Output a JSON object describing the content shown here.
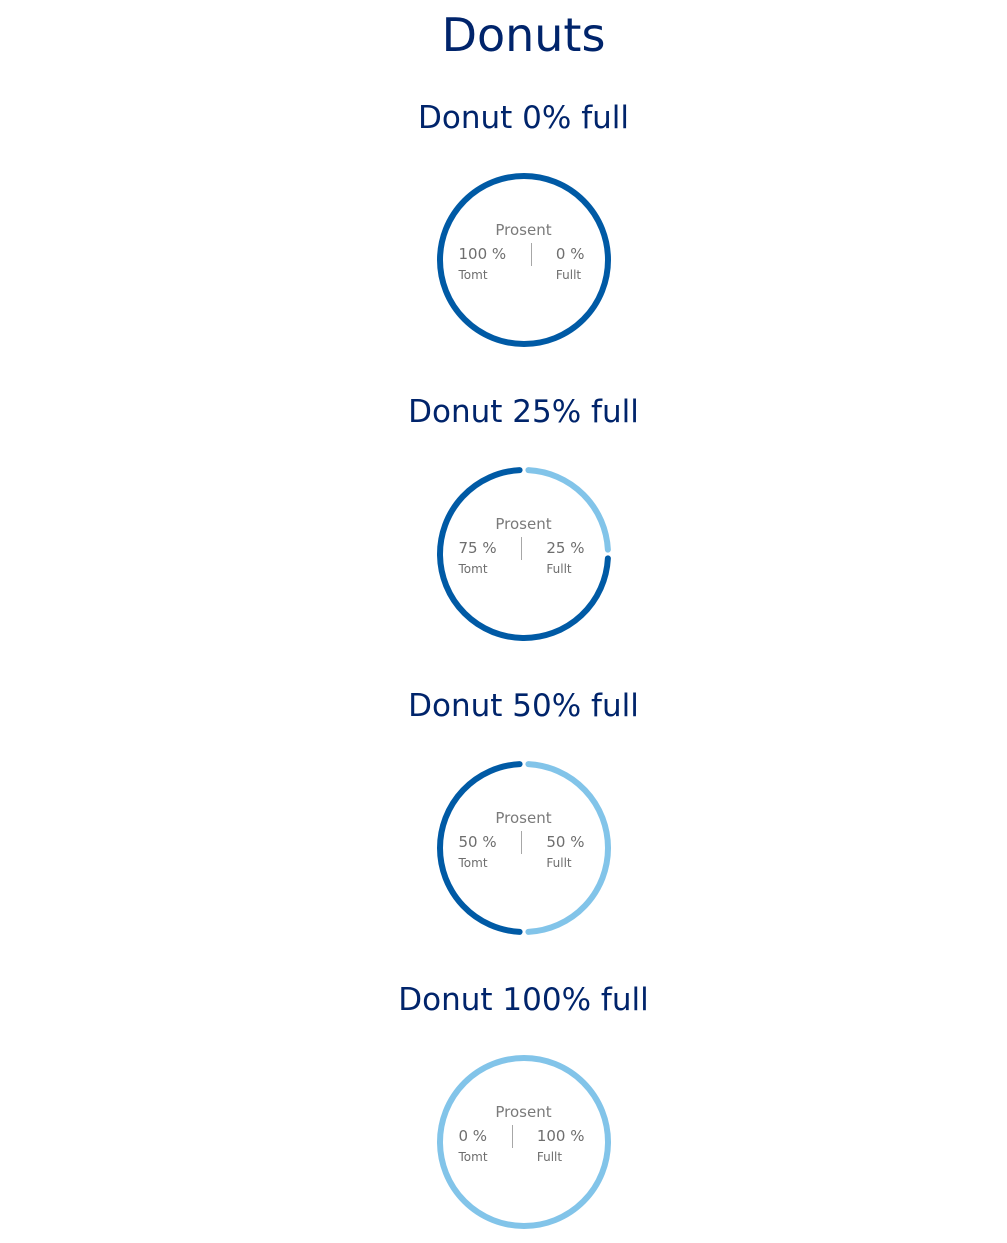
{
  "page": {
    "title": "Donuts"
  },
  "colors": {
    "title": "#00246b",
    "empty": "#005aa5",
    "full": "#82c4e9",
    "text": "#6e6e6e",
    "divider": "#a7a7a7"
  },
  "chart_data": [
    {
      "type": "pie",
      "title": "Donut 0% full",
      "center_label": "Prosent",
      "slices": [
        {
          "name": "Tomt",
          "value": 100,
          "value_label": "100 %",
          "color": "#005aa5"
        },
        {
          "name": "Fullt",
          "value": 0,
          "value_label": "0 %",
          "color": "#82c4e9"
        }
      ]
    },
    {
      "type": "pie",
      "title": "Donut 25% full",
      "center_label": "Prosent",
      "slices": [
        {
          "name": "Tomt",
          "value": 75,
          "value_label": "75 %",
          "color": "#005aa5"
        },
        {
          "name": "Fullt",
          "value": 25,
          "value_label": "25 %",
          "color": "#82c4e9"
        }
      ]
    },
    {
      "type": "pie",
      "title": "Donut 50% full",
      "center_label": "Prosent",
      "slices": [
        {
          "name": "Tomt",
          "value": 50,
          "value_label": "50 %",
          "color": "#005aa5"
        },
        {
          "name": "Fullt",
          "value": 50,
          "value_label": "50 %",
          "color": "#82c4e9"
        }
      ]
    },
    {
      "type": "pie",
      "title": "Donut 100% full",
      "center_label": "Prosent",
      "slices": [
        {
          "name": "Tomt",
          "value": 0,
          "value_label": "0 %",
          "color": "#005aa5"
        },
        {
          "name": "Fullt",
          "value": 100,
          "value_label": "100 %",
          "color": "#82c4e9"
        }
      ]
    }
  ]
}
